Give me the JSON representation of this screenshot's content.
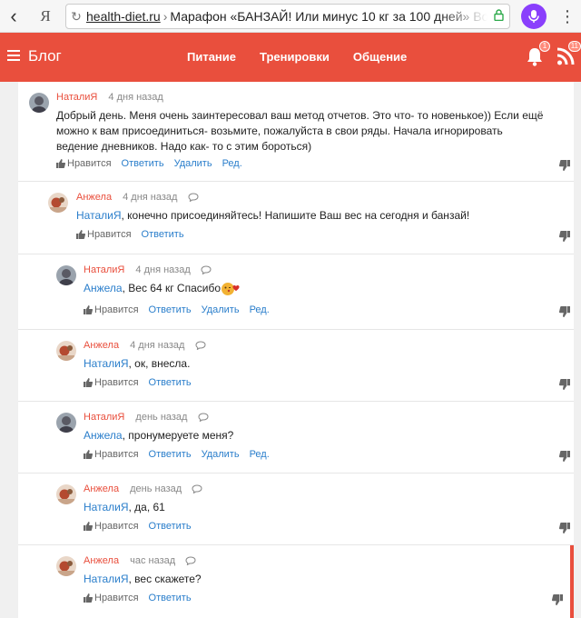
{
  "browser": {
    "back": "‹",
    "ya": "Я",
    "url_domain": "health-diet.ru",
    "url_sep": "›",
    "url_title": "Марафон «БАНЗАЙ! Или минус 10 кг за 100 дней» Во",
    "menu": "⋮"
  },
  "header": {
    "blog": "Блог",
    "nav": [
      "Питание",
      "Тренировки",
      "Общение"
    ],
    "notif_count": "1",
    "rss_count": "11"
  },
  "labels": {
    "like": "Нравится",
    "reply": "Ответить",
    "delete": "Удалить",
    "edit": "Ред."
  },
  "comments": [
    {
      "author": "НаталиЯ",
      "time": "4 дня назад",
      "mention": "",
      "text": "Добрый день. Меня очень заинтересовал ваш метод отчетов. Это что- то новенькое)) Если ещё можно к вам присоединиться- возьмите, пожалуйста в свои ряды. Начала игнорировать ведение дневников. Надо как- то с этим бороться)"
    },
    {
      "author": "Анжела",
      "time": "4 дня назад",
      "mention": "НаталиЯ",
      "text": ", конечно присоединяйтесь! Напишите Ваш вес на сегодня и банзай!"
    },
    {
      "author": "НаталиЯ",
      "time": "4 дня назад",
      "mention": "Анжела",
      "text": ", Вес 64 кг Спасибо"
    },
    {
      "author": "Анжела",
      "time": "4 дня назад",
      "mention": "НаталиЯ",
      "text": ", ок, внесла."
    },
    {
      "author": "НаталиЯ",
      "time": "день назад",
      "mention": "Анжела",
      "text": ", пронумеруете меня?"
    },
    {
      "author": "Анжела",
      "time": "день назад",
      "mention": "НаталиЯ",
      "text": ", да, 61"
    },
    {
      "author": "Анжела",
      "time": "час назад",
      "mention": "НаталиЯ",
      "text": ", вес скажете?"
    }
  ],
  "colors": {
    "brand": "#e94f3d",
    "link": "#2a7ecb"
  }
}
